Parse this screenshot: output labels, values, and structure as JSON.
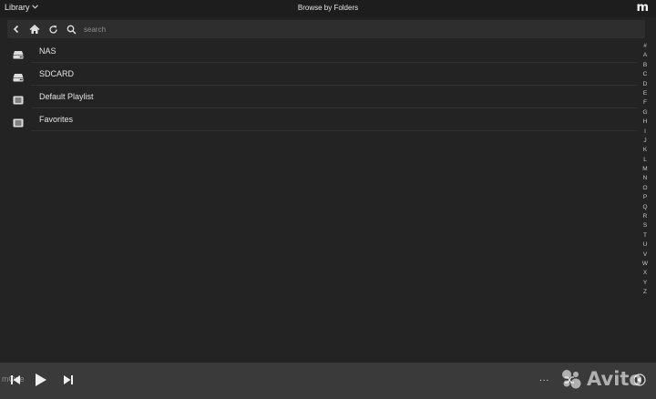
{
  "header": {
    "menu_label": "Library",
    "title": "Browse by Folders",
    "logo_text": "m"
  },
  "navbar": {
    "icons": [
      "back-icon",
      "home-icon",
      "refresh-icon",
      "search-icon"
    ],
    "search_placeholder": "search",
    "search_value": ""
  },
  "folders": [
    {
      "label": "NAS",
      "icon": "hdd-icon"
    },
    {
      "label": "SDCARD",
      "icon": "hdd-icon"
    },
    {
      "label": "Default Playlist",
      "icon": "playlist-icon"
    },
    {
      "label": "Favorites",
      "icon": "playlist-icon"
    }
  ],
  "alphabet": [
    "#",
    "A",
    "B",
    "C",
    "D",
    "E",
    "F",
    "G",
    "H",
    "I",
    "J",
    "K",
    "L",
    "M",
    "N",
    "O",
    "P",
    "Q",
    "R",
    "S",
    "T",
    "U",
    "V",
    "W",
    "X",
    "Y",
    "Z"
  ],
  "player": {
    "now_playing": "mOde",
    "more_label": "...",
    "icons": [
      "previous-icon",
      "play-icon",
      "next-icon",
      "shuffle-icon",
      "volume-icon"
    ]
  },
  "watermark": {
    "text": "Avito"
  },
  "colors": {
    "background": "#232323",
    "topbar": "#1d1d1d",
    "navbar": "#2e2e2e",
    "player": "#3a3a3a",
    "text": "#e4e4e4"
  }
}
